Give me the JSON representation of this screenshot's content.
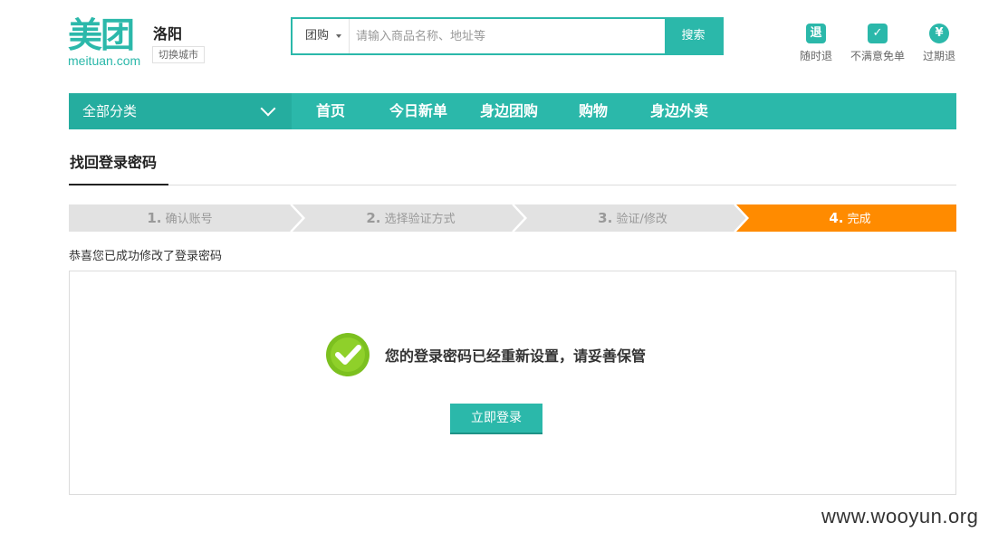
{
  "header": {
    "logo_text": "美团",
    "logo_sub": "meituan.com",
    "city": "洛阳",
    "switch_city": "切换城市"
  },
  "search": {
    "category": "团购",
    "placeholder": "请输入商品名称、地址等",
    "button": "搜索"
  },
  "promises": [
    {
      "icon": "退",
      "label": "随时退"
    },
    {
      "icon": "✓",
      "label": "不满意免单"
    },
    {
      "icon": "¥",
      "label": "过期退"
    }
  ],
  "nav": {
    "all_categories": "全部分类",
    "items": [
      "首页",
      "今日新单",
      "身边团购",
      "购物",
      "身边外卖"
    ]
  },
  "page": {
    "tab_title": "找回登录密码",
    "steps": [
      {
        "num": "1.",
        "label": "确认账号",
        "active": false
      },
      {
        "num": "2.",
        "label": "选择验证方式",
        "active": false
      },
      {
        "num": "3.",
        "label": "验证/修改",
        "active": false
      },
      {
        "num": "4.",
        "label": "完成",
        "active": true
      }
    ],
    "congrats": "恭喜您已成功修改了登录密码",
    "success_message": "您的登录密码已经重新设置，请妥善保管",
    "login_button": "立即登录"
  },
  "watermark": "www.wooyun.org",
  "colors": {
    "brand": "#2bb8aa",
    "step_active": "#ff8b00",
    "step_inactive": "#e2e2e2",
    "check": "#7cc01f"
  }
}
